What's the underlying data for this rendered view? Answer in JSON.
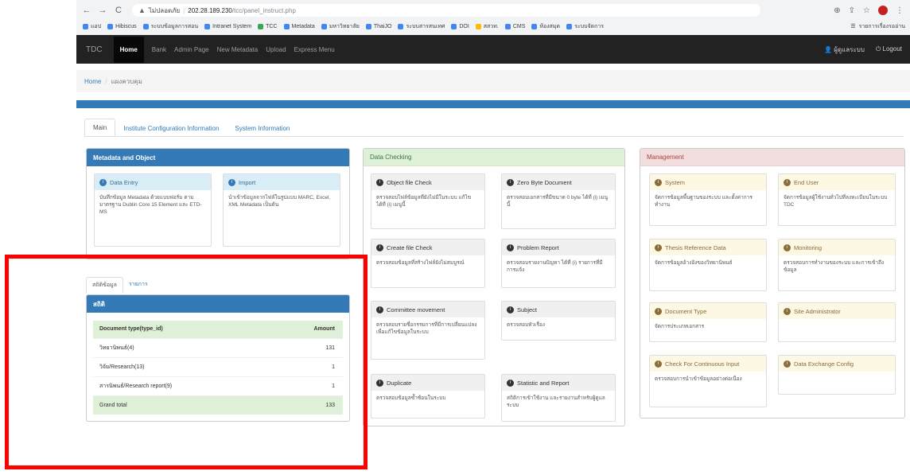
{
  "browser": {
    "nav": {
      "back": "←",
      "forward": "→",
      "reload": "C"
    },
    "url": {
      "security": "ไม่ปลอดภัย",
      "host": "202.28.189.230",
      "path": "/tcc/panel_instruct.php"
    },
    "bookmarks": [
      "แอป",
      "Hibiscus",
      "ระบบข้อมูลการสอน",
      "Intranet System",
      "TCC",
      "Metadata",
      "มหาวิทยาลัย",
      "ThaiJO",
      "ระบบสารสนเทศ",
      "DOI",
      "สสวท.",
      "CMS",
      "ห้องสมุด",
      "ระบบจัดการ"
    ],
    "bookmarks_right": "รายการเรื่องรออ่าน"
  },
  "navbar": {
    "brand": "TDC",
    "items": [
      "Home",
      "Bank",
      "Admin Page",
      "New Metadata",
      "Upload",
      "Express Menu"
    ],
    "user": "ผู้ดูแลระบบ",
    "logout": "Logout"
  },
  "breadcrumb": {
    "home": "Home",
    "current": "แผงควบคุม"
  },
  "main_tabs": [
    "Main",
    "Institute Configuration Information",
    "System Information"
  ],
  "metadata_panel": {
    "title": "Metadata and Object",
    "cards": [
      {
        "title": "Data Entry",
        "body": "บันทึกข้อมูล Metadata ด้วยแบบฟอร์ม ตามมาตรฐาน Dublin Core 15 Element และ ETD-MS"
      },
      {
        "title": "Import",
        "body": "นำเข้าข้อมูลจากไฟล์ในรูปแบบ MARC, Excel, XML Metadata เป็นต้น"
      }
    ]
  },
  "stats": {
    "sub_tabs": [
      "สถิติข้อมูล",
      "รายการ"
    ],
    "title": "สถิติ",
    "table_headers": [
      "Document type(type_id)",
      "Amount"
    ],
    "rows": [
      {
        "type": "วิทยานิพนธ์(4)",
        "amount": "131"
      },
      {
        "type": "วิจัย/Research(13)",
        "amount": "1"
      },
      {
        "type": "สารนิพนธ์/Research report(9)",
        "amount": "1"
      }
    ],
    "total": {
      "label": "Grand total",
      "amount": "133"
    }
  },
  "data_checking": {
    "title": "Data Checking",
    "cards": [
      {
        "title": "Object file Check",
        "body": "ตรวจสอบไฟล์ข้อมูลที่ยังไม่มีในระบบ แก้ไขได้ที่ (i) เมนูนี้",
        "icon": "i"
      },
      {
        "title": "Zero Byte Document",
        "body": "ตรวจสอบเอกสารที่มีขนาด 0 byte ได้ที่ (i) เมนูนี้",
        "icon": "i"
      },
      {
        "title": "Create file Check",
        "body": "ตรวจสอบข้อมูลที่สร้างไฟล์ยังไม่สมบูรณ์",
        "icon": "i"
      },
      {
        "title": "Problem Report",
        "body": "ตรวจสอบรายงานปัญหา ได้ที่ (i) รายการที่มีการแจ้ง",
        "icon": "i"
      },
      {
        "title": "Committee movement",
        "body": "ตรวจสอบรายชื่อกรรมการที่มีการเปลี่ยนแปลง เพื่อแก้ไขข้อมูลในระบบ",
        "icon": "i"
      },
      {
        "title": "Subject",
        "body": "ตรวจสอบหัวเรื่อง",
        "icon": "i"
      },
      {
        "title": "Duplicate",
        "body": "ตรวจสอบข้อมูลซ้ำซ้อนในระบบ",
        "icon": "i"
      },
      {
        "title": "Statistic and Report",
        "body": "สถิติการเข้าใช้งาน และรายงานสำหรับผู้ดูแลระบบ",
        "icon": "i"
      }
    ]
  },
  "management": {
    "title": "Management",
    "cards": [
      {
        "title": "System",
        "body": "จัดการข้อมูลพื้นฐานของระบบ และตั้งค่าการทำงาน"
      },
      {
        "title": "End User",
        "body": "จัดการข้อมูลผู้ใช้งานทั่วไปที่ลงทะเบียนในระบบ TDC"
      },
      {
        "title": "Thesis Reference Data",
        "body": "จัดการข้อมูลอ้างอิงของวิทยานิพนธ์"
      },
      {
        "title": "Monitoring",
        "body": "ตรวจสอบการทำงานของระบบ และการเข้าถึงข้อมูล"
      },
      {
        "title": "Document Type",
        "body": "จัดการประเภทเอกสาร"
      },
      {
        "title": "Site Administrator",
        "body": ""
      },
      {
        "title": "Check For Continuous Input",
        "body": "ตรวจสอบการนำเข้าข้อมูลอย่างต่อเนื่อง"
      },
      {
        "title": "Data Exchange Config",
        "body": ""
      }
    ]
  },
  "colors": {
    "primary": "#337ab7",
    "success_bg": "#dff0d8",
    "danger_bg": "#f2dede",
    "warning_bg": "#fcf8e3",
    "highlight": "#ff0000",
    "navbar": "#222222"
  }
}
